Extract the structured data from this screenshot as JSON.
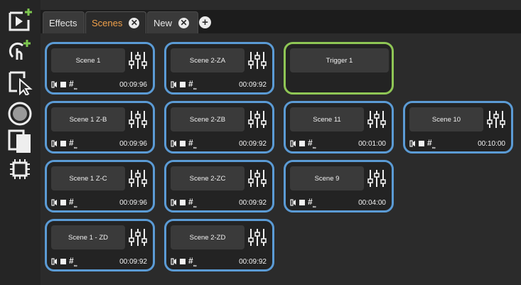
{
  "toolbar": {
    "tools": [
      {
        "icon": "add-scene-icon"
      },
      {
        "icon": "add-trigger-icon"
      },
      {
        "icon": "select-icon"
      },
      {
        "icon": "record-icon"
      },
      {
        "icon": "duplicate-icon"
      },
      {
        "icon": "select-all-icon"
      }
    ]
  },
  "tabs": [
    {
      "label": "Effects",
      "active": false
    },
    {
      "label": "Scenes",
      "active": true
    },
    {
      "label": "New",
      "active": false
    }
  ],
  "colors": {
    "scene_border": "#5b9bd5",
    "trigger_border": "#8fc655",
    "active_tab_text": "#f0a04a"
  },
  "scenes": [
    {
      "name": "Scene 1",
      "time": "00:09:96"
    },
    {
      "name": "Scene 2-ZA",
      "time": "00:09:92"
    },
    {
      "name": "Trigger 1"
    },
    {
      "name": "Scene 1 Z-B",
      "time": "00:09:96"
    },
    {
      "name": "Scene 2-ZB",
      "time": "00:09:92"
    },
    {
      "name": "Scene 11",
      "time": "00:01:00"
    },
    {
      "name": "Scene 10",
      "time": "00:10:00"
    },
    {
      "name": "Scene 1 Z-C",
      "time": "00:09:96"
    },
    {
      "name": "Scene 2-ZC",
      "time": "00:09:92"
    },
    {
      "name": "Scene 9",
      "time": "00:04:00"
    },
    {
      "name": "Scene 1 - ZD",
      "time": "00:09:92"
    },
    {
      "name": "Scene 2-ZD",
      "time": "00:09:92"
    }
  ]
}
